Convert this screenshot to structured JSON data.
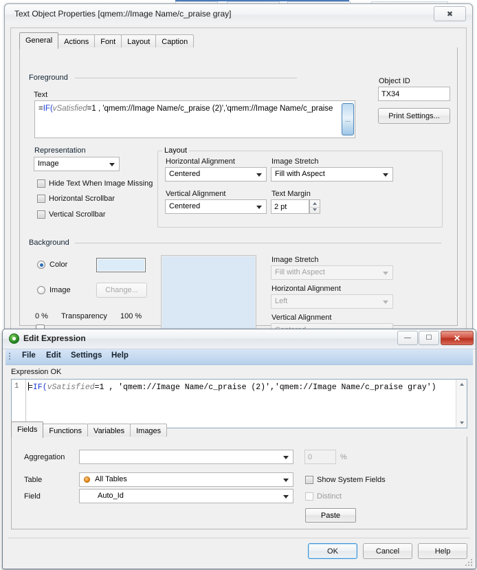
{
  "window1": {
    "title": "Text Object Properties [qmem://Image Name/c_praise gray]",
    "close_icon": "close-icon",
    "tabs": [
      {
        "label": "General",
        "active": true
      },
      {
        "label": "Actions",
        "active": false
      },
      {
        "label": "Font",
        "active": false
      },
      {
        "label": "Layout",
        "active": false
      },
      {
        "label": "Caption",
        "active": false
      }
    ],
    "foreground": {
      "legend": "Foreground",
      "text_label": "Text",
      "expression": {
        "prefix": "=",
        "func": "IF(",
        "variable": "vSatisfied",
        "rest": "=1 , 'qmem://Image Name/c_praise (2)','qmem://Image Name/c_praise"
      },
      "dots_button": "...",
      "object_id_label": "Object ID",
      "object_id_value": "TX34",
      "print_settings_label": "Print Settings..."
    },
    "representation": {
      "legend": "Representation",
      "value": "Image",
      "checkboxes": [
        {
          "label": "Hide Text When Image Missing",
          "checked": false
        },
        {
          "label": "Horizontal Scrollbar",
          "checked": false
        },
        {
          "label": "Vertical Scrollbar",
          "checked": false
        }
      ]
    },
    "layout": {
      "legend": "Layout",
      "horizontal_alignment_label": "Horizontal Alignment",
      "horizontal_alignment_value": "Centered",
      "vertical_alignment_label": "Vertical Alignment",
      "vertical_alignment_value": "Centered",
      "image_stretch_label": "Image Stretch",
      "image_stretch_value": "Fill with Aspect",
      "text_margin_label": "Text Margin",
      "text_margin_value": "2 pt"
    },
    "background": {
      "legend": "Background",
      "color_radio_label": "Color",
      "color_radio_selected": true,
      "image_radio_label": "Image",
      "image_radio_selected": false,
      "change_button_label": "Change...",
      "transparency_label": "Transparency",
      "transparency_min": "0 %",
      "transparency_max": "100 %",
      "color_swatch": "#dcebf8",
      "preview_color": "#dae8f5",
      "image_stretch_label": "Image Stretch",
      "image_stretch_value": "Fill with Aspect",
      "horizontal_alignment_label": "Horizontal Alignment",
      "horizontal_alignment_value": "Left",
      "vertical_alignment_label": "Vertical Alignment",
      "vertical_alignment_value": "Centered"
    }
  },
  "window2": {
    "title": "Edit Expression",
    "app_icon": "qlikview-q-icon",
    "minimize_icon": "minimize-icon",
    "maximize_icon": "maximize-icon",
    "close_icon": "close-icon",
    "menus": [
      {
        "label": "File"
      },
      {
        "label": "Edit"
      },
      {
        "label": "Settings"
      },
      {
        "label": "Help"
      }
    ],
    "status": "Expression OK",
    "editor": {
      "line_number": "1",
      "code": {
        "prefix": "=",
        "func": "IF(",
        "variable": "vSatisfied",
        "rest": "=1 , 'qmem://Image Name/c_praise (2)','qmem://Image Name/c_praise gray')"
      }
    },
    "tabs": [
      {
        "label": "Fields",
        "active": true
      },
      {
        "label": "Functions",
        "active": false
      },
      {
        "label": "Variables",
        "active": false
      },
      {
        "label": "Images",
        "active": false
      }
    ],
    "fields_tab": {
      "aggregation_label": "Aggregation",
      "aggregation_value": "",
      "percent_value": "0",
      "percent_symbol": "%",
      "table_label": "Table",
      "table_value": "All Tables",
      "field_label": "Field",
      "field_value": "Auto_Id",
      "show_system_fields_label": "Show System Fields",
      "show_system_fields_checked": false,
      "distinct_label": "Distinct",
      "distinct_checked": false,
      "paste_button_label": "Paste"
    },
    "buttons": {
      "ok": "OK",
      "cancel": "Cancel",
      "help": "Help"
    }
  }
}
